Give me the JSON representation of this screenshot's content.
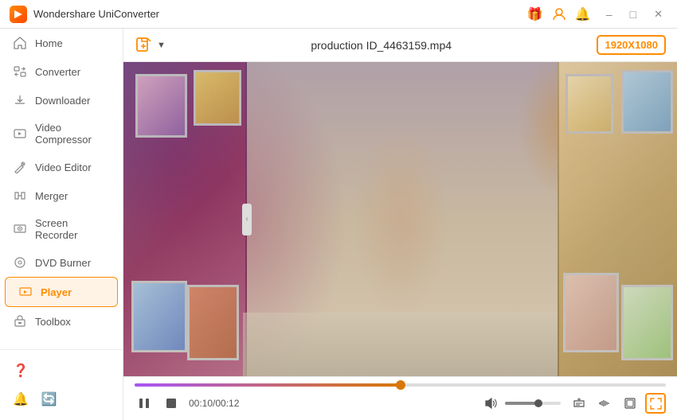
{
  "titlebar": {
    "app_name": "Wondershare UniConverter",
    "logo_alt": "UniConverter Logo"
  },
  "sidebar": {
    "items": [
      {
        "id": "home",
        "label": "Home",
        "icon": "🏠"
      },
      {
        "id": "converter",
        "label": "Converter",
        "icon": "🔄"
      },
      {
        "id": "downloader",
        "label": "Downloader",
        "icon": "⬇️"
      },
      {
        "id": "video-compressor",
        "label": "Video Compressor",
        "icon": "🗜️"
      },
      {
        "id": "video-editor",
        "label": "Video Editor",
        "icon": "✂️"
      },
      {
        "id": "merger",
        "label": "Merger",
        "icon": "🔀"
      },
      {
        "id": "screen-recorder",
        "label": "Screen Recorder",
        "icon": "📹"
      },
      {
        "id": "dvd-burner",
        "label": "DVD Burner",
        "icon": "💿"
      },
      {
        "id": "player",
        "label": "Player",
        "icon": "▶️"
      },
      {
        "id": "toolbox",
        "label": "Toolbox",
        "icon": "🧰"
      }
    ],
    "active_item": "player",
    "bottom_icons": [
      "help",
      "bell",
      "refresh"
    ]
  },
  "video_toolbar": {
    "add_file_label": "+",
    "filename": "production ID_4463159.mp4",
    "resolution": "1920X1080"
  },
  "video_controls": {
    "time_current": "00:10/00:12",
    "progress_percent": 50,
    "volume_percent": 60,
    "play_icon": "⏸",
    "stop_icon": "⏹",
    "volume_icon": "🔊",
    "subtitle_icon": "T↑",
    "waveform_icon": "≋",
    "crop_icon": "⊡",
    "fullscreen_icon": "⛶"
  }
}
